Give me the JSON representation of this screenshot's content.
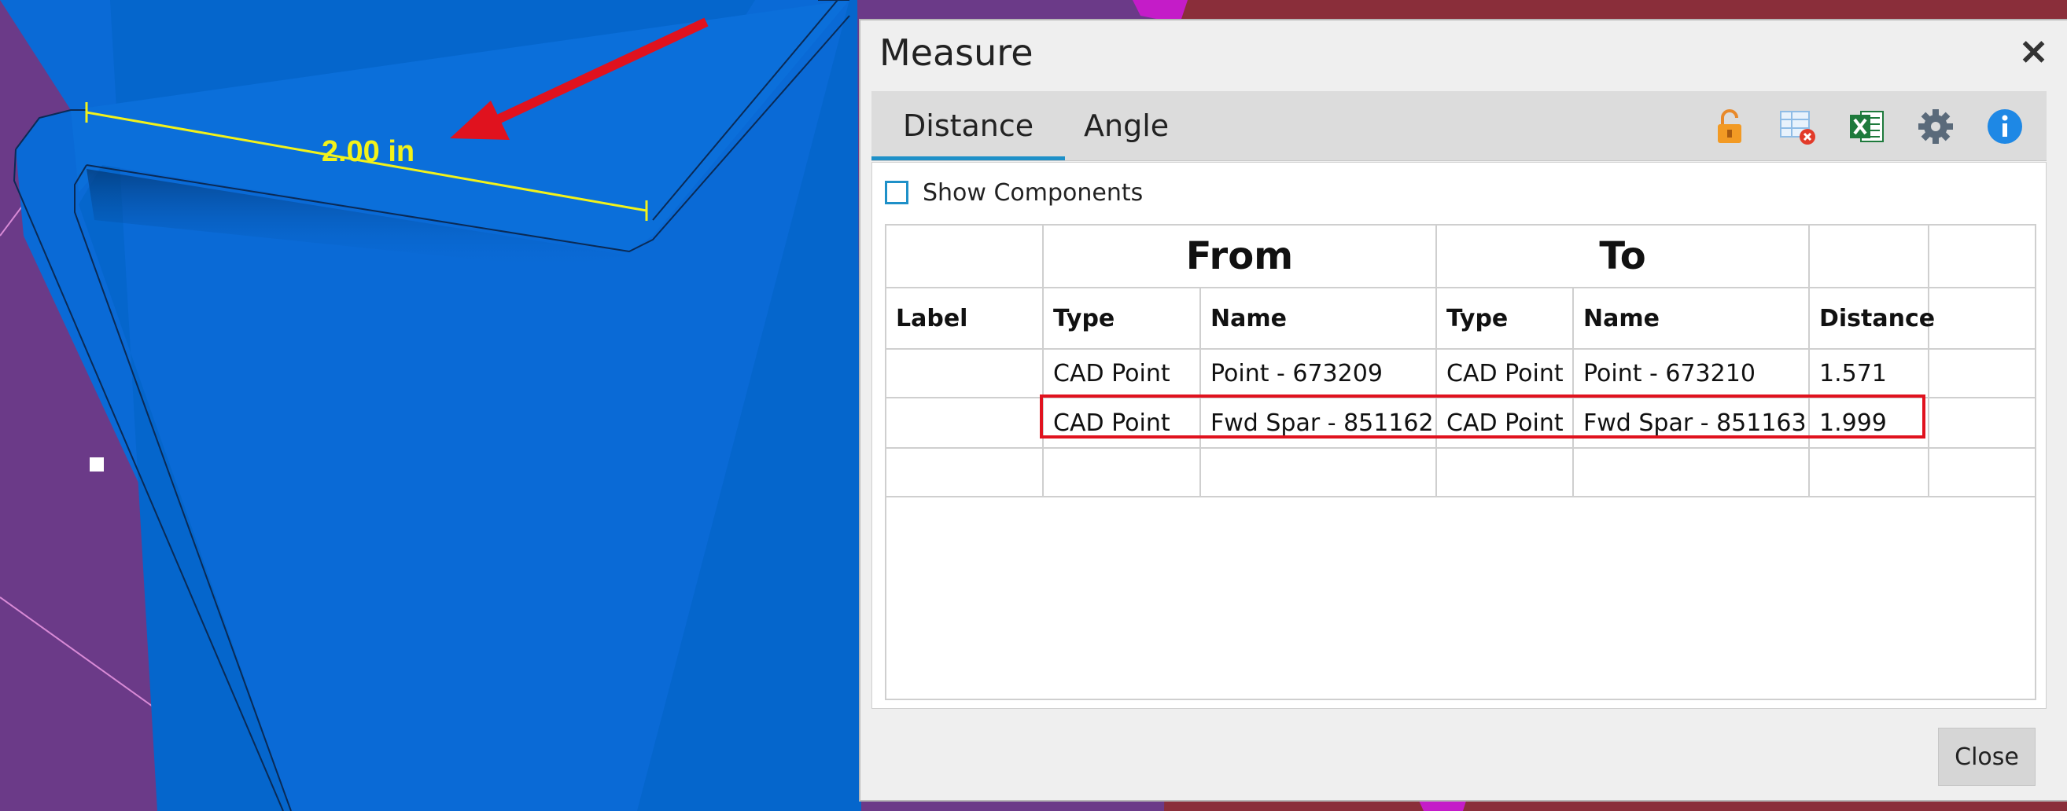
{
  "viewport": {
    "measurement_label": "2.00 in",
    "colors": {
      "background": "#8a2e3a",
      "purple_region": "#6b3a88",
      "part_blue": "#0a6ad6",
      "annotation_yellow": "#f2f21a",
      "arrow_red": "#e0121e",
      "magenta": "#c41cc8"
    }
  },
  "dialog": {
    "title": "Measure",
    "close_x": "✕",
    "tabs": [
      {
        "label": "Distance",
        "active": true
      },
      {
        "label": "Angle",
        "active": false
      }
    ],
    "toolbar_icons": [
      "unlock-icon",
      "delete-table-icon",
      "excel-export-icon",
      "gear-icon",
      "info-icon"
    ],
    "show_components": {
      "label": "Show Components",
      "checked": false
    },
    "table": {
      "group_headers": {
        "from": "From",
        "to": "To"
      },
      "columns": [
        "Label",
        "Type",
        "Name",
        "Type",
        "Name",
        "Distance"
      ],
      "rows": [
        {
          "label": "",
          "from_type": "CAD Point",
          "from_name": "Point - 673209",
          "to_type": "CAD Point",
          "to_name": "Point - 673210",
          "distance": "1.571"
        },
        {
          "label": "",
          "from_type": "CAD Point",
          "from_name": "Fwd Spar - 851162",
          "to_type": "CAD Point",
          "to_name": "Fwd Spar - 851163",
          "distance": "1.999"
        }
      ]
    },
    "close_button": "Close",
    "accent_color": "#1e90c8",
    "highlight_color": "#e0121e"
  }
}
